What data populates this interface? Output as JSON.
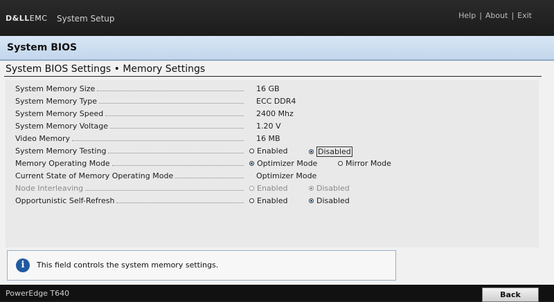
{
  "header": {
    "logo_main": "D&LL",
    "logo_light": "EMC",
    "app_title": "System Setup",
    "links": [
      "Help",
      "About",
      "Exit"
    ],
    "separator": "|"
  },
  "section": {
    "title": "System BIOS"
  },
  "page": {
    "title": "System BIOS Settings • Memory Settings"
  },
  "settings": [
    {
      "label": "System Memory Size",
      "value": "16 GB"
    },
    {
      "label": "System Memory Type",
      "value": "ECC DDR4"
    },
    {
      "label": "System Memory Speed",
      "value": "2400 Mhz"
    },
    {
      "label": "System Memory Voltage",
      "value": "1.20 V"
    },
    {
      "label": "Video Memory",
      "value": "16 MB"
    },
    {
      "label": "System Memory Testing",
      "options": [
        "Enabled",
        "Disabled"
      ],
      "selected": "Disabled"
    },
    {
      "label": "Memory Operating Mode",
      "options": [
        "Optimizer Mode",
        "Mirror Mode"
      ],
      "selected": "Optimizer Mode"
    },
    {
      "label": "Current State of Memory Operating Mode",
      "value": "Optimizer Mode"
    },
    {
      "label": "Node Interleaving",
      "options": [
        "Enabled",
        "Disabled"
      ],
      "selected": "Disabled",
      "disabled": true
    },
    {
      "label": "Opportunistic Self-Refresh",
      "options": [
        "Enabled",
        "Disabled"
      ],
      "selected": "Disabled"
    }
  ],
  "help": {
    "icon": "info-icon",
    "text": "This field controls the system memory settings."
  },
  "footer": {
    "model": "PowerEdge T640",
    "back_label": "Back"
  }
}
